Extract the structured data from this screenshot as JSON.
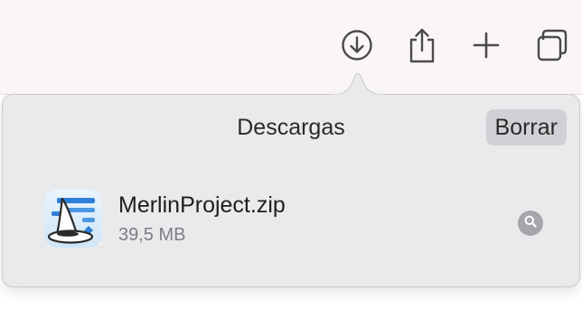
{
  "toolbar": {
    "buttons": [
      {
        "name": "download-icon",
        "label": "Downloads"
      },
      {
        "name": "share-icon",
        "label": "Share"
      },
      {
        "name": "plus-icon",
        "label": "New tab"
      },
      {
        "name": "tabs-overview-icon",
        "label": "Tab overview"
      }
    ]
  },
  "downloads_popover": {
    "title": "Descargas",
    "clear_label": "Borrar",
    "items": [
      {
        "file_name": "MerlinProject.zip",
        "file_size": "39,5 MB",
        "icon": "merlin-project-app-icon",
        "action_icon": "magnifier-icon"
      }
    ]
  },
  "colors": {
    "toolbar_bg": "#faf6f6",
    "popover_bg": "#e8eaec",
    "clear_button_bg": "#cfd1d4",
    "secondary_text": "#7c7e82",
    "icon_gray": "#4a4a4a"
  }
}
